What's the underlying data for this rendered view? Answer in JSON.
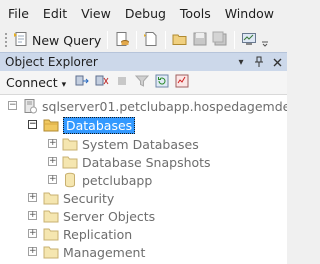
{
  "menu": [
    "File",
    "Edit",
    "View",
    "Debug",
    "Tools",
    "Window"
  ],
  "toolbar": {
    "new_query_label": "New Query"
  },
  "panel": {
    "title": "Object Explorer"
  },
  "explorer_toolbar": {
    "connect_label": "Connect"
  },
  "tree": {
    "server": "sqlserver01.petclubapp.hospedagemdesites.w",
    "databases": "Databases",
    "system_databases": "System Databases",
    "database_snapshots": "Database Snapshots",
    "petclubapp": "petclubapp",
    "security": "Security",
    "server_objects": "Server Objects",
    "replication": "Replication",
    "management": "Management"
  },
  "colors": {
    "accent": "#3399ff",
    "panel_header": "#ccd8ea",
    "folder": "#f0c860"
  }
}
